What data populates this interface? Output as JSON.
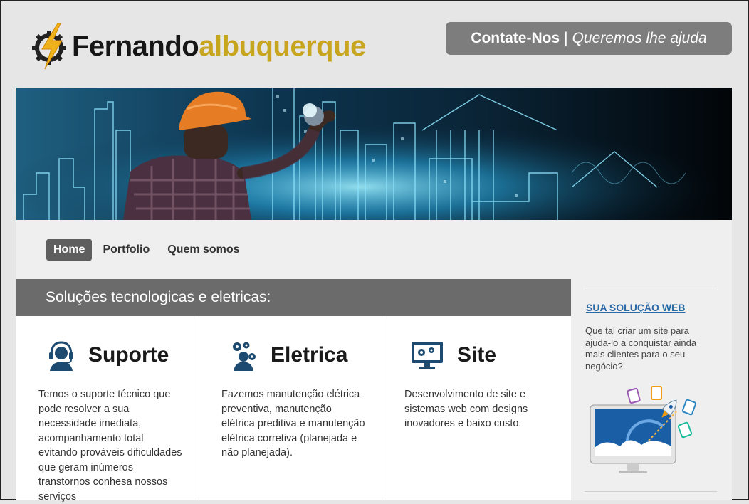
{
  "logo": {
    "part1": "Fernando",
    "part2": "albuquerque"
  },
  "contact": {
    "main": "Contate-Nos",
    "separator": "|",
    "tagline": "Queremos lhe ajuda"
  },
  "nav": {
    "items": [
      {
        "label": "Home"
      },
      {
        "label": "Portfolio"
      },
      {
        "label": "Quem somos"
      }
    ]
  },
  "main": {
    "header": "Soluções tecnologicas e eletricas:",
    "columns": [
      {
        "title": "Suporte",
        "icon": "headset-support-icon",
        "text": "Temos o suporte técnico que pode resolver a sua necessidade imediata, acompanhamento total evitando prováveis dificuldades que geram inúmeros transtornos conhesa nossos serviços"
      },
      {
        "title": "Eletrica",
        "icon": "gears-person-icon",
        "text": "Fazemos manutenção elétrica preventiva, manutenção elétrica preditiva e manutenção elétrica corretiva (planejada e não planejada)."
      },
      {
        "title": "Site",
        "icon": "monitor-settings-icon",
        "text": "Desenvolvimento de site e sistemas web com designs inovadores e baixo custo."
      }
    ]
  },
  "sidebar": {
    "title": "SUA SOLUÇÃO WEB",
    "text": "Que tal criar um site para ajuda-lo a conquistar ainda mais clientes para o seu negócio?"
  },
  "colors": {
    "brand_gold": "#c8a51e",
    "header_gray": "#6b6b6b",
    "link_blue": "#2a6aa6",
    "hero_cyan": "#5fd8ff"
  }
}
